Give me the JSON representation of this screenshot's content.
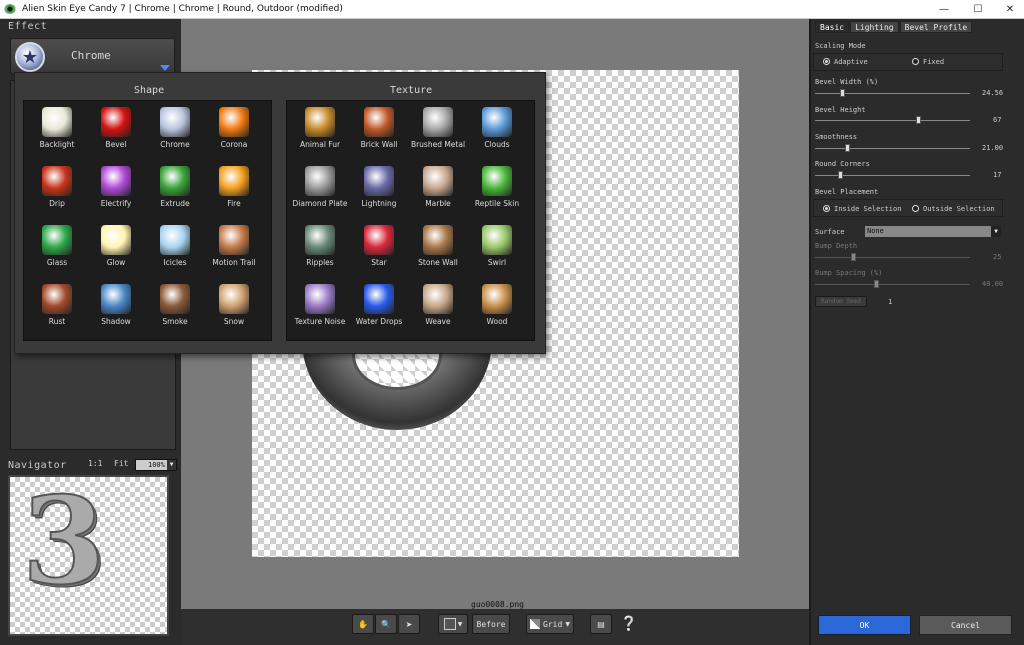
{
  "window": {
    "title": "Alien Skin Eye Candy 7 | Chrome | Chrome | Round, Outdoor (modified)",
    "minimize": "—",
    "maximize": "☐",
    "close": "✕"
  },
  "left_panel": {
    "effect_heading": "Effect",
    "effect_name": "Chrome",
    "navigator_heading": "Navigator",
    "zoom_1to1": "1:1",
    "zoom_fit": "Fit",
    "zoom_value": "100%"
  },
  "navigator": {
    "preview_glyph": "3"
  },
  "popup": {
    "shape_title": "Shape",
    "texture_title": "Texture",
    "shape_items": [
      {
        "label": "Backlight",
        "icon": "backlight-icon",
        "color": "#e8e8d8"
      },
      {
        "label": "Bevel",
        "icon": "bevel-icon",
        "color": "#d41111"
      },
      {
        "label": "Chrome",
        "icon": "chrome-icon",
        "color": "#b8c4e0"
      },
      {
        "label": "Corona",
        "icon": "corona-icon",
        "color": "#f07a10"
      },
      {
        "label": "Drip",
        "icon": "drip-icon",
        "color": "#c8341a"
      },
      {
        "label": "Electrify",
        "icon": "electrify-icon",
        "color": "#b04ad8"
      },
      {
        "label": "Extrude",
        "icon": "extrude-icon",
        "color": "#3aa43a"
      },
      {
        "label": "Fire",
        "icon": "fire-icon",
        "color": "#f4a020"
      },
      {
        "label": "Glass",
        "icon": "glass-icon",
        "color": "#2fa84a"
      },
      {
        "label": "Glow",
        "icon": "glow-icon",
        "color": "#fff4b0"
      },
      {
        "label": "Icicles",
        "icon": "icicles-icon",
        "color": "#a8d4f0"
      },
      {
        "label": "Motion Trail",
        "icon": "motion-trail-icon",
        "color": "#c47a4a"
      },
      {
        "label": "Rust",
        "icon": "rust-icon",
        "color": "#a04a2a"
      },
      {
        "label": "Shadow",
        "icon": "shadow-icon",
        "color": "#4a88c8"
      },
      {
        "label": "Smoke",
        "icon": "smoke-icon",
        "color": "#8a5a3a"
      },
      {
        "label": "Snow",
        "icon": "snow-icon",
        "color": "#d0a070"
      }
    ],
    "texture_items": [
      {
        "label": "Animal Fur",
        "icon": "animal-fur-icon",
        "color": "#c88a2a"
      },
      {
        "label": "Brick Wall",
        "icon": "brick-wall-icon",
        "color": "#c05a2a"
      },
      {
        "label": "Brushed Metal",
        "icon": "brushed-metal-icon",
        "color": "#a8a8a8"
      },
      {
        "label": "Clouds",
        "icon": "clouds-icon",
        "color": "#5a9ad8"
      },
      {
        "label": "Diamond Plate",
        "icon": "diamond-plate-icon",
        "color": "#9a9a9a"
      },
      {
        "label": "Lightning",
        "icon": "lightning-icon",
        "color": "#6a6aa8"
      },
      {
        "label": "Marble",
        "icon": "marble-icon",
        "color": "#c8a890"
      },
      {
        "label": "Reptile Skin",
        "icon": "reptile-skin-icon",
        "color": "#4ab83a"
      },
      {
        "label": "Ripples",
        "icon": "ripples-icon",
        "color": "#6a8a7a"
      },
      {
        "label": "Star",
        "icon": "star-icon",
        "color": "#d8283a"
      },
      {
        "label": "Stone Wall",
        "icon": "stone-wall-icon",
        "color": "#a8784a"
      },
      {
        "label": "Swirl",
        "icon": "swirl-icon",
        "color": "#9ac86a"
      },
      {
        "label": "Texture Noise",
        "icon": "texture-noise-icon",
        "color": "#9a7ac8"
      },
      {
        "label": "Water Drops",
        "icon": "water-drops-icon",
        "color": "#2a5ae8"
      },
      {
        "label": "Weave",
        "icon": "weave-icon",
        "color": "#c8a888"
      },
      {
        "label": "Wood",
        "icon": "wood-icon",
        "color": "#c8904a"
      }
    ]
  },
  "canvas": {
    "filename": "guo0008.png"
  },
  "toolbar": {
    "before_label": "Before",
    "grid_label": "Grid"
  },
  "right_panel": {
    "tabs": [
      "Basic",
      "Lighting",
      "Bevel Profile"
    ],
    "scaling_mode_label": "Scaling Mode",
    "adaptive_label": "Adaptive",
    "fixed_label": "Fixed",
    "scaling_selected": "Adaptive",
    "bevel_width_label": "Bevel Width (%)",
    "bevel_width_value": "24.56",
    "bevel_width_fraction": 0.18,
    "bevel_height_label": "Bevel Height",
    "bevel_height_value": "67",
    "bevel_height_fraction": 0.67,
    "smoothness_label": "Smoothness",
    "smoothness_value": "21.00",
    "smoothness_fraction": 0.21,
    "round_corners_label": "Round Corners",
    "round_corners_value": "17",
    "round_corners_fraction": 0.17,
    "bevel_placement_label": "Bevel Placement",
    "inside_label": "Inside Selection",
    "outside_label": "Outside Selection",
    "placement_selected": "Inside Selection",
    "surface_label": "Surface",
    "surface_value": "None",
    "bump_depth_label": "Bump Depth",
    "bump_depth_value": "25",
    "bump_depth_fraction": 0.25,
    "bump_spacing_label": "Bump Spacing (%)",
    "bump_spacing_value": "40.00",
    "bump_spacing_fraction": 0.4,
    "random_seed_label": "Random Seed",
    "random_seed_value": "1",
    "ok_label": "OK",
    "cancel_label": "Cancel"
  }
}
